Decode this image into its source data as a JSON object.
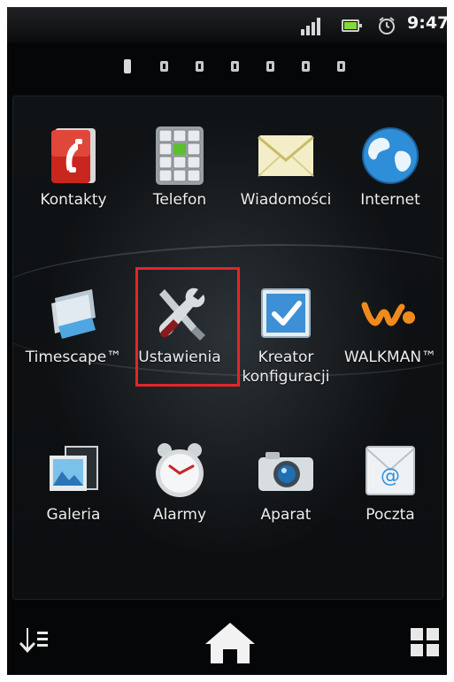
{
  "status_bar": {
    "time": "9:47",
    "icons": [
      "signal-icon",
      "battery-icon",
      "alarm-clock-icon"
    ]
  },
  "pager": {
    "pages": 7,
    "active_index": 0
  },
  "apps": [
    {
      "label": "Kontakty",
      "icon": "contacts-icon"
    },
    {
      "label": "Telefon",
      "icon": "phone-dialpad-icon"
    },
    {
      "label": "Wiadomości",
      "icon": "messages-envelope-icon"
    },
    {
      "label": "Internet",
      "icon": "globe-icon"
    },
    {
      "label": "Timescape™",
      "icon": "timescape-icon"
    },
    {
      "label": "Ustawienia",
      "icon": "settings-tools-icon",
      "highlighted": true
    },
    {
      "label": "Kreator\nkonfiguracji",
      "icon": "checkbox-icon"
    },
    {
      "label": "WALKMAN™",
      "icon": "walkman-icon"
    },
    {
      "label": "Galeria",
      "icon": "gallery-icon"
    },
    {
      "label": "Alarmy",
      "icon": "alarm-clock-icon"
    },
    {
      "label": "Aparat",
      "icon": "camera-icon"
    },
    {
      "label": "Poczta",
      "icon": "email-icon"
    }
  ],
  "bottom_bar": {
    "left": "sort-icon",
    "center": "home-icon",
    "right": "app-grid-icon"
  },
  "colors": {
    "highlight": "#e3262a",
    "background": "#050607",
    "label": "#eeeeee"
  }
}
